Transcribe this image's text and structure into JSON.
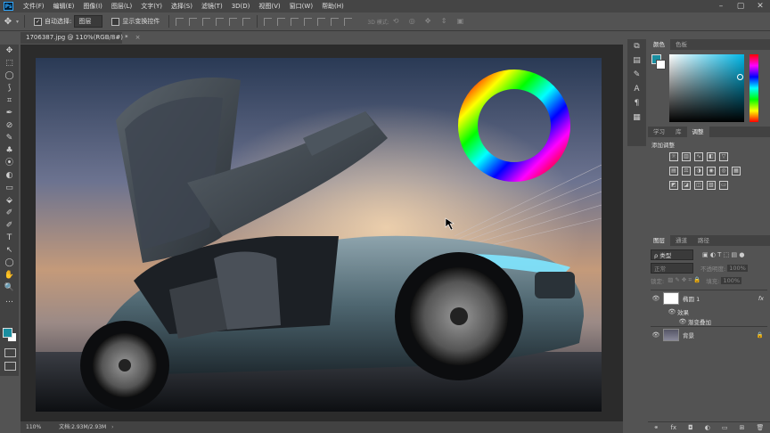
{
  "menu": {
    "logo": "Ps",
    "items": [
      "文件(F)",
      "编辑(E)",
      "图像(I)",
      "图层(L)",
      "文字(Y)",
      "选择(S)",
      "滤镜(T)",
      "3D(D)",
      "视图(V)",
      "窗口(W)",
      "帮助(H)"
    ]
  },
  "window_controls": {
    "minimize": "–",
    "restore": "▢",
    "close": "✕"
  },
  "options": {
    "auto_select_checked": "✓",
    "auto_select_label": "自动选择:",
    "auto_select_value": "图层",
    "transform_label": "显示变换控件",
    "mode3d_label": "3D 模式:"
  },
  "document": {
    "tab_title": "1706387.jpg @ 110%(RGB/8#) *",
    "zoom": "110%",
    "doc_size": "文档:2.93M/2.93M"
  },
  "tools": [
    "✥",
    "⬚",
    "◯",
    "⟆",
    "⌗",
    "✒",
    "⊘",
    "✎",
    "♣",
    "⦿",
    "◐",
    "▭",
    "⬙",
    "✐",
    "T",
    "↖",
    "◯",
    "✋",
    "🔍",
    "…"
  ],
  "color_panel": {
    "tabs": [
      "颜色",
      "色板"
    ],
    "fg_color": "#1a8ea0",
    "bg_color": "#ffffff"
  },
  "adjust_panel": {
    "tabs": [
      "学习",
      "库",
      "调整"
    ],
    "title": "添加调整"
  },
  "layers_panel": {
    "tabs": [
      "图层",
      "通道",
      "路径"
    ],
    "filter_label": "ρ 类型",
    "blend_mode": "正常",
    "opacity_label": "不透明度:",
    "opacity_value": "100%",
    "lock_label": "锁定:",
    "fill_label": "填充:",
    "fill_value": "100%",
    "layers": [
      {
        "name": "椭圆 1",
        "fx": "fx"
      },
      {
        "name": "效果"
      },
      {
        "name": "渐变叠加"
      },
      {
        "name": "背景"
      }
    ]
  }
}
